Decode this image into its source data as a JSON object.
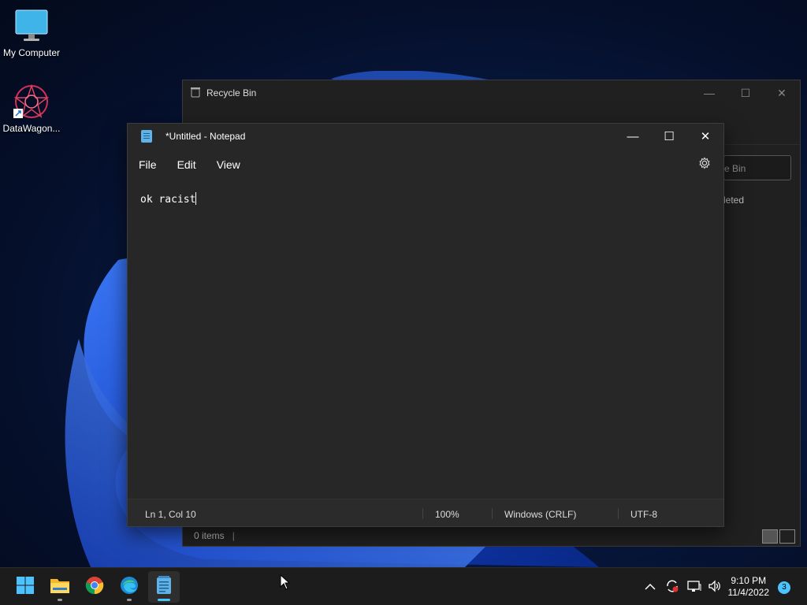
{
  "desktop": {
    "icons": [
      {
        "label": "My Computer"
      },
      {
        "label": "DataWagon..."
      }
    ]
  },
  "recycle_bin": {
    "title": "Recycle Bin",
    "search_placeholder": "e Bin",
    "empty_message": "leted",
    "status_items": "0 items",
    "controls": {
      "minimize": "—",
      "maximize": "☐",
      "close": "✕"
    }
  },
  "notepad": {
    "title": "*Untitled - Notepad",
    "menu": [
      "File",
      "Edit",
      "View"
    ],
    "content": "ok racist",
    "status": {
      "position": "Ln 1, Col 10",
      "zoom": "100%",
      "line_ending": "Windows (CRLF)",
      "encoding": "UTF-8"
    },
    "controls": {
      "minimize": "—",
      "maximize": "☐",
      "close": "✕"
    }
  },
  "taskbar": {
    "apps": [
      "start-icon",
      "file-explorer-icon",
      "chrome-icon",
      "edge-icon",
      "notepad-icon"
    ],
    "active_app": "notepad-icon",
    "clock_time": "9:10 PM",
    "clock_date": "11/4/2022",
    "notification_count": "3"
  },
  "colors": {
    "accent": "#4cc2ff",
    "window_bg": "#272727"
  }
}
